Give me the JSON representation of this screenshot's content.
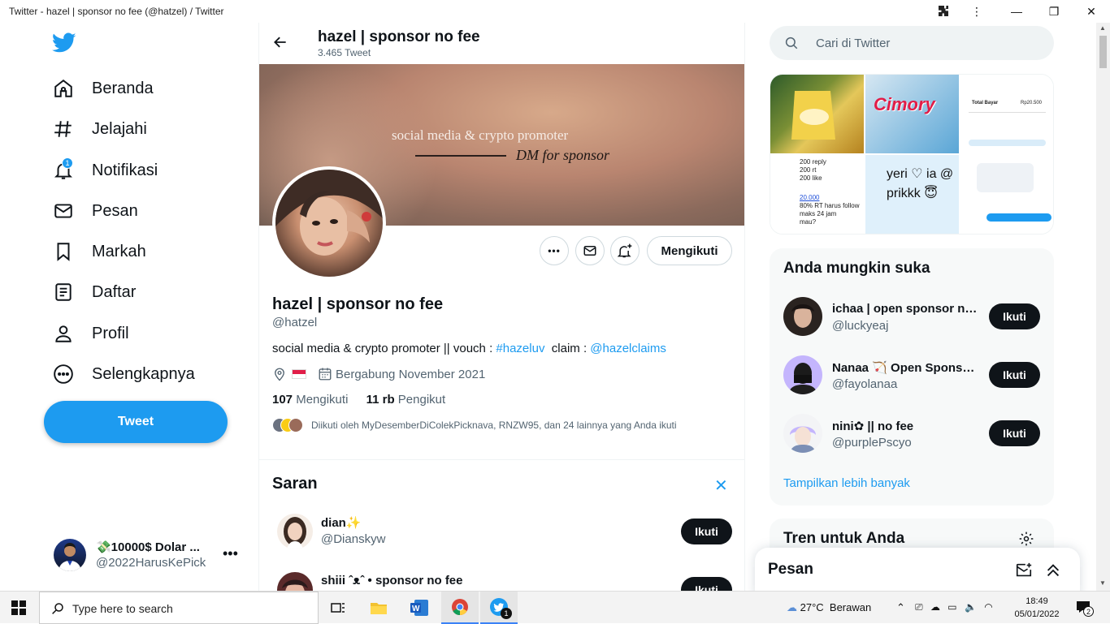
{
  "window": {
    "title": "Twitter - hazel | sponsor no fee (@hatzel) / Twitter"
  },
  "nav": {
    "items": [
      {
        "label": "Beranda",
        "icon": "home-icon"
      },
      {
        "label": "Jelajahi",
        "icon": "hashtag-icon"
      },
      {
        "label": "Notifikasi",
        "icon": "bell-icon",
        "badge": "1"
      },
      {
        "label": "Pesan",
        "icon": "envelope-icon"
      },
      {
        "label": "Markah",
        "icon": "bookmark-icon"
      },
      {
        "label": "Daftar",
        "icon": "list-icon"
      },
      {
        "label": "Profil",
        "icon": "person-icon"
      },
      {
        "label": "Selengkapnya",
        "icon": "more-circle-icon"
      }
    ],
    "tweet_label": "Tweet",
    "account": {
      "name": "💸10000$ Dolar ...",
      "handle": "@2022HarusKePick"
    }
  },
  "profile": {
    "header_name": "hazel | sponsor no fee",
    "tweet_count": "3.465 Tweet",
    "banner_line1": "social media & crypto promoter",
    "banner_line2": "DM for sponsor",
    "name": "hazel | sponsor no fee",
    "handle": "@hatzel",
    "bio_prefix": "social media & crypto promoter || vouch : ",
    "bio_tag": "#hazeluv",
    "bio_mid": "  claim : ",
    "bio_mention": "@hazelclaims",
    "flag": "🇮🇩",
    "joined": "Bergabung November 2021",
    "following_count": "107",
    "following_label": "Mengikuti",
    "followers_count": "11 rb",
    "followers_label": "Pengikut",
    "followed_by": "Diikuti oleh MyDesemberDiColekPicknava, RNZW95, dan 24 lainnya yang Anda ikuti",
    "follow_state": "Mengikuti"
  },
  "suggestions": {
    "title": "Saran",
    "items": [
      {
        "name": "dian✨",
        "handle": "@Dianskyw",
        "button": "Ikuti"
      },
      {
        "name": "shiii ˆᴥˆ • sponsor no fee",
        "handle": "",
        "button": "Ikuti"
      }
    ]
  },
  "right": {
    "search_placeholder": "Cari di Twitter",
    "media": {
      "cell2": "Cimory",
      "cell3_total": "Total Bayar",
      "cell3_amount": "Rp20.500",
      "cell4": "200 reply\n200 rt\n200 like",
      "cell4b": "20.000",
      "cell4c": "80% RT harus follow\nmaks 24 jam\nmau?",
      "cell5": "yeri ♡ ia @\nprikkk 😇"
    },
    "you_might_like": {
      "title": "Anda mungkin suka",
      "items": [
        {
          "name": "ichaa | open sponsor no fee",
          "handle": "@luckyeaj",
          "button": "Ikuti"
        },
        {
          "name": "Nanaa 🏹 Open Sponsor no fee",
          "handle": "@fayolanaa",
          "button": "Ikuti"
        },
        {
          "name": "nini✿ || no fee",
          "handle": "@purplePscyo",
          "button": "Ikuti"
        }
      ],
      "more": "Tampilkan lebih banyak"
    },
    "trends_title": "Tren untuk Anda",
    "dm_title": "Pesan"
  },
  "taskbar": {
    "search_placeholder": "Type here to search",
    "weather": "27°C  Berawan",
    "time": "18:49",
    "date": "05/01/2022",
    "notif_count": "2",
    "twitter_badge": "1"
  },
  "colors": {
    "accent": "#1d9bf0",
    "text": "#0f1419",
    "secondary": "#536471"
  }
}
